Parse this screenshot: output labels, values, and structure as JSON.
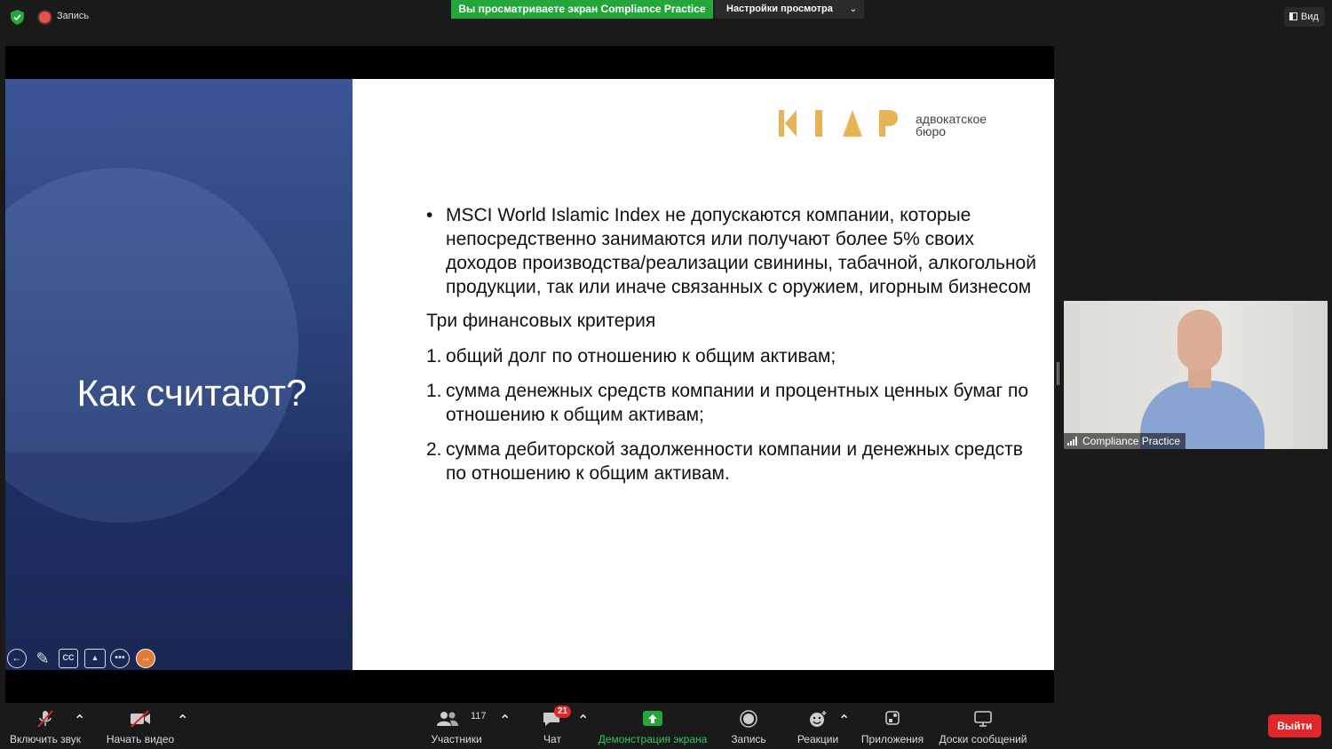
{
  "top_bar": {
    "record_label": "Запись",
    "share_banner": "Вы просматриваете экран Compliance Practice",
    "view_settings": "Настройки просмотра",
    "view_button": "Вид"
  },
  "slide": {
    "title": "Как считают?",
    "logo_text_line1": "адвокатское",
    "logo_text_line2": "бюро",
    "bullet": "MSCI World Islamic Index не допускаются компании, которые непосредственно занимаются или получают более 5% своих доходов производства/реализации свинины, табачной, алкогольной продукции, так или иначе связанных с оружием, игорным бизнесом",
    "subheading": "Три финансовых критерия",
    "criteria": [
      {
        "num": "1.",
        "text": "общий долг по отношению к общим активам;"
      },
      {
        "num": "1.",
        "text": "сумма денежных средств компании и процентных ценных бумаг по отношению к общим активам;"
      },
      {
        "num": "2.",
        "text": "сумма дебиторской задолженности компании и денежных средств по отношению к общим активам."
      }
    ]
  },
  "slide_controls": {
    "cc_label": "CC"
  },
  "video": {
    "participant_name": "Compliance Practice"
  },
  "toolbar": {
    "unmute": "Включить звук",
    "start_video": "Начать видео",
    "participants": "Участники",
    "participants_count": "117",
    "chat": "Чат",
    "chat_badge": "21",
    "share_screen": "Демонстрация экрана",
    "record": "Запись",
    "reactions": "Реакции",
    "apps": "Приложения",
    "whiteboards": "Доски сообщений",
    "leave": "Выйти"
  },
  "colors": {
    "share_green": "#23a73b",
    "leave_red": "#e02828",
    "logo_gold": "#e6b455"
  }
}
